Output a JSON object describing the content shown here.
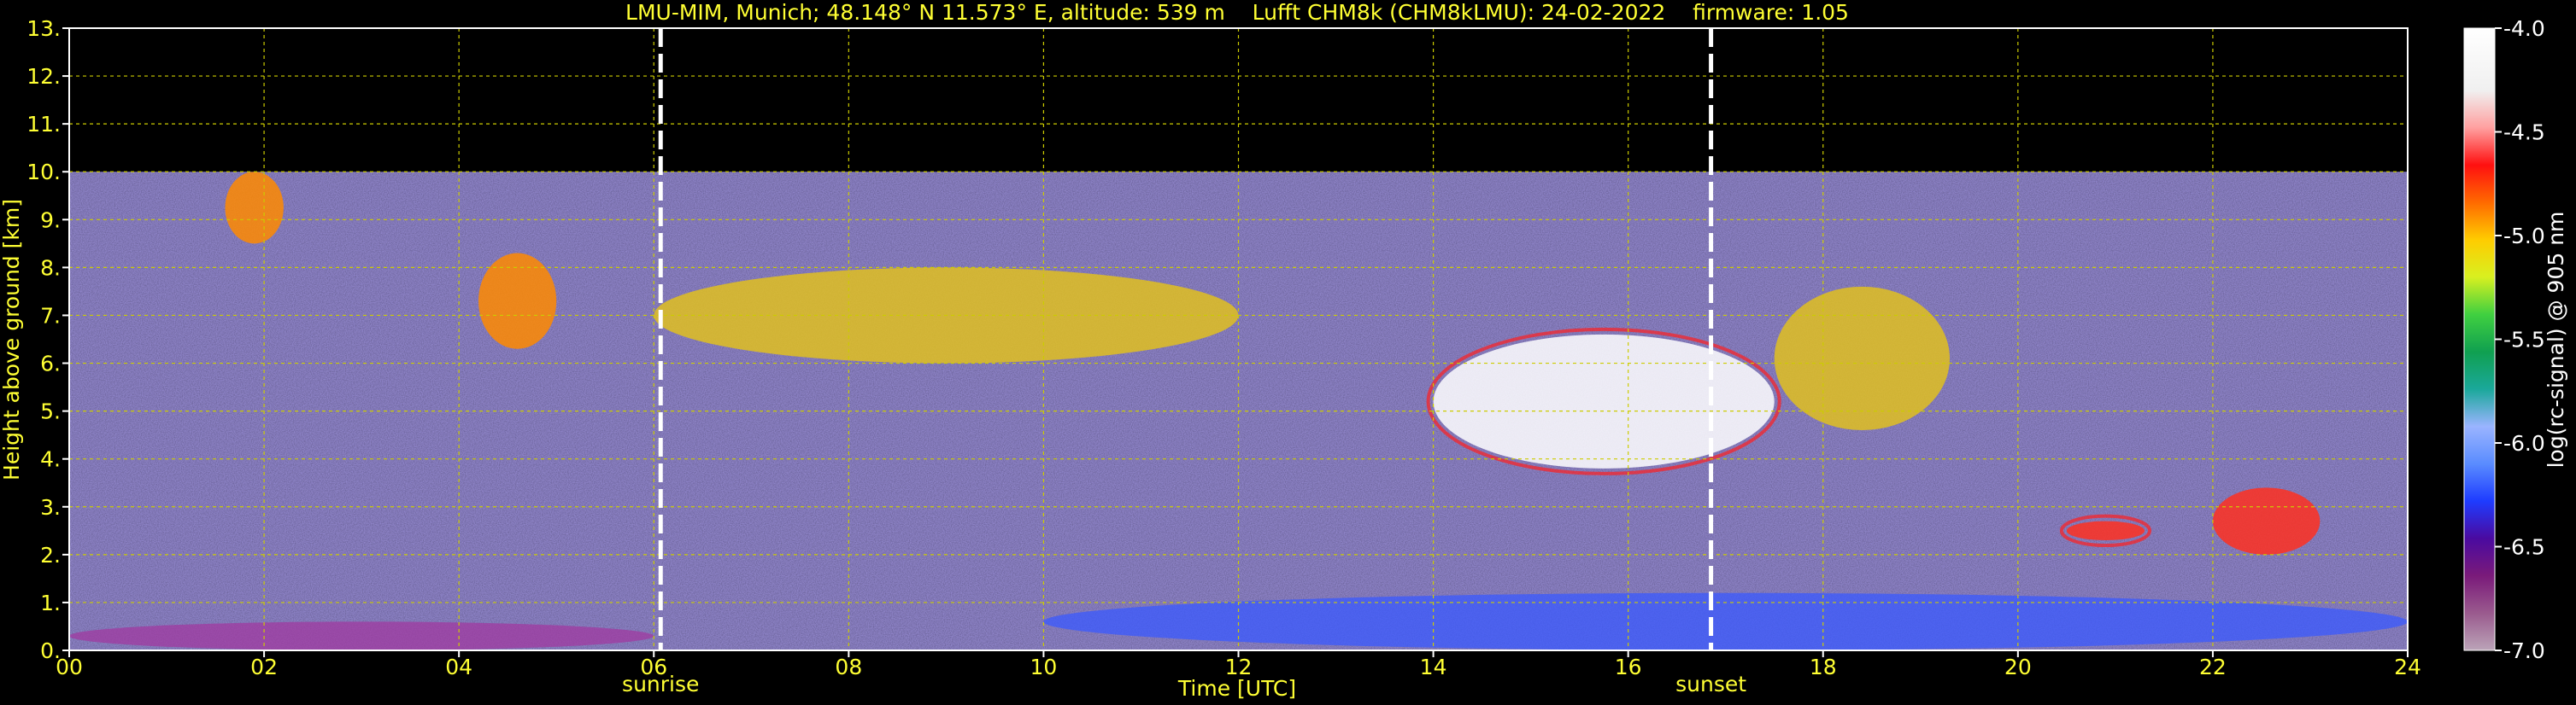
{
  "chart_data": {
    "type": "heatmap",
    "title": "LMU-MIM, Munich; 48.148° N 11.573° E, altitude: 539 m    Lufft CHM8k (CHM8kLMU): 24-02-2022    firmware: 1.05",
    "xlabel": "Time [UTC]",
    "ylabel": "Height above ground [km]",
    "xlim": [
      0,
      24
    ],
    "ylim": [
      0,
      13
    ],
    "x_ticks": [
      "00",
      "02",
      "04",
      "06",
      "08",
      "10",
      "12",
      "14",
      "16",
      "18",
      "20",
      "22",
      "24"
    ],
    "x_tick_values": [
      0,
      2,
      4,
      6,
      8,
      10,
      12,
      14,
      16,
      18,
      20,
      22,
      24
    ],
    "y_ticks": [
      "0.",
      "1.",
      "2.",
      "3.",
      "4.",
      "5.",
      "6.",
      "7.",
      "8.",
      "9.",
      "10.",
      "11.",
      "12.",
      "13."
    ],
    "y_tick_values": [
      0,
      1,
      2,
      3,
      4,
      5,
      6,
      7,
      8,
      9,
      10,
      11,
      12,
      13
    ],
    "grid": true,
    "grid_color": "#cccc00",
    "data_top_km": 10,
    "annotations": [
      {
        "label": "sunrise",
        "x": 6.07
      },
      {
        "label": "sunset",
        "x": 16.85
      }
    ],
    "colorbar": {
      "label": "log(rc-signal) @ 905 nm",
      "min": -7.0,
      "max": -4.0,
      "ticks": [
        "-4.0",
        "-4.5",
        "-5.0",
        "-5.5",
        "-6.0",
        "-6.5",
        "-7.0"
      ],
      "tick_values": [
        -4.0,
        -4.5,
        -5.0,
        -5.5,
        -6.0,
        -6.5,
        -7.0
      ]
    },
    "features": [
      {
        "name": "cirrus_high",
        "x": [
          1.6,
          2.2
        ],
        "y": [
          8.5,
          10.0
        ],
        "intensity": -5.0
      },
      {
        "name": "cirrus_0430",
        "x": [
          4.2,
          5.0
        ],
        "y": [
          6.3,
          8.3
        ],
        "intensity": -5.0
      },
      {
        "name": "cirrus_band",
        "x": [
          6.0,
          12.0
        ],
        "y": [
          6.0,
          8.0
        ],
        "intensity": -5.3
      },
      {
        "name": "cirrus_thick",
        "x": [
          14.0,
          17.5
        ],
        "y": [
          3.8,
          6.6
        ],
        "intensity": -4.2
      },
      {
        "name": "cirrus_evening",
        "x": [
          17.5,
          19.3
        ],
        "y": [
          4.6,
          7.6
        ],
        "intensity": -5.2
      },
      {
        "name": "cloud_low_1",
        "x": [
          20.5,
          21.3
        ],
        "y": [
          2.3,
          2.7
        ],
        "intensity": -4.5
      },
      {
        "name": "cloud_low_2",
        "x": [
          22.0,
          23.1
        ],
        "y": [
          2.0,
          3.4
        ],
        "intensity": -4.8
      },
      {
        "name": "boundary_layer_night",
        "x": [
          0,
          6
        ],
        "y": [
          0,
          0.6
        ],
        "intensity": -6.6
      },
      {
        "name": "boundary_layer_day",
        "x": [
          10,
          24
        ],
        "y": [
          0,
          1.2
        ],
        "intensity": -6.2
      }
    ]
  }
}
